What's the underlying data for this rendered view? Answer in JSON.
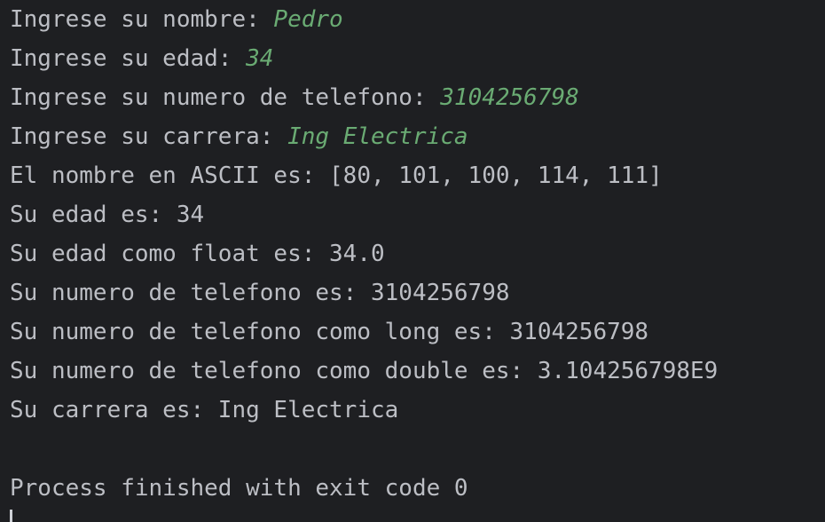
{
  "console": {
    "input_lines": [
      {
        "prompt": "Ingrese su nombre: ",
        "value": "Pedro"
      },
      {
        "prompt": "Ingrese su edad: ",
        "value": "34"
      },
      {
        "prompt": "Ingrese su numero de telefono: ",
        "value": "3104256798"
      },
      {
        "prompt": "Ingrese su carrera: ",
        "value": "Ing Electrica"
      }
    ],
    "output_lines": [
      "El nombre en ASCII es: [80, 101, 100, 114, 111]",
      "Su edad es: 34",
      "Su edad como float es: 34.0",
      "Su numero de telefono es: 3104256798",
      "Su numero de telefono como long es: 3104256798",
      "Su numero de telefono como double es: 3.104256798E9",
      "Su carrera es: Ing Electrica"
    ],
    "exit_message": "Process finished with exit code 0"
  },
  "colors": {
    "background": "#1e1f22",
    "text": "#bcbec4",
    "user_input": "#6aab73"
  }
}
